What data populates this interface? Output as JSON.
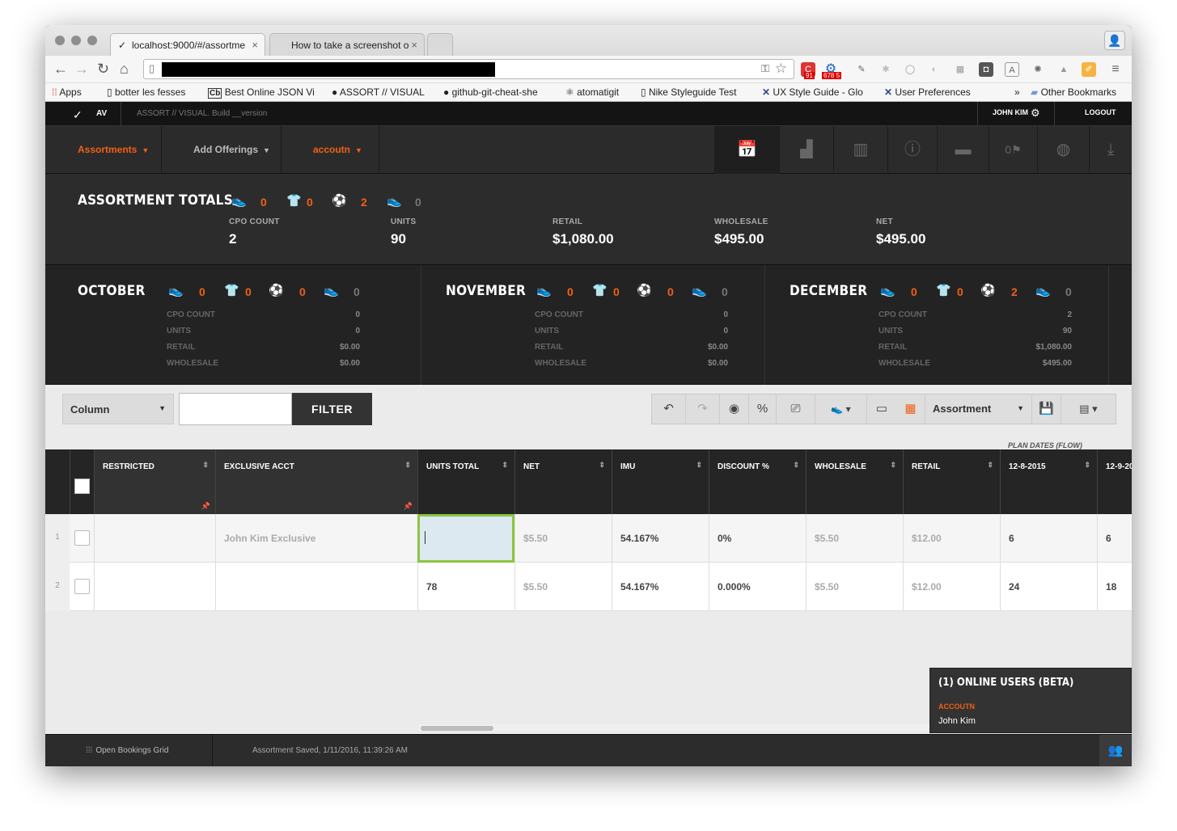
{
  "browser": {
    "tabs": [
      {
        "title": "localhost:9000/#/assortme",
        "icon": "nike-swoosh-icon"
      },
      {
        "title": "How to take a screenshot o",
        "icon": "apple-icon"
      }
    ],
    "bookmarks": [
      {
        "label": "Apps",
        "icon": "apps-grid-icon"
      },
      {
        "label": "botter les fesses",
        "icon": "page-icon"
      },
      {
        "label": "Best Online JSON Vi",
        "icon": "cb-icon"
      },
      {
        "label": "ASSORT // VISUAL",
        "icon": "github-icon"
      },
      {
        "label": "github-git-cheat-she",
        "icon": "github-icon"
      },
      {
        "label": "atomatigit",
        "icon": "atom-icon"
      },
      {
        "label": "Nike Styleguide Test",
        "icon": "page-icon"
      },
      {
        "label": "UX Style Guide - Glo",
        "icon": "x-icon"
      },
      {
        "label": "User Preferences",
        "icon": "x-icon"
      },
      {
        "label": "»",
        "icon": ""
      },
      {
        "label": "Other Bookmarks",
        "icon": "folder-icon"
      }
    ],
    "badges": {
      "ext1": "91",
      "ext2": "678 5"
    }
  },
  "app": {
    "logo_text": "AV",
    "build": "ASSORT // VISUAL. Build __version",
    "user": "JOHN KIM",
    "logout": "LOGOUT",
    "menu": {
      "assortments": "Assortments",
      "add_offerings": "Add Offerings",
      "account": "accoutn"
    },
    "flag_count": "0"
  },
  "totals": {
    "title": "ASSORTMENT TOTALS",
    "counts": {
      "footwear": "0",
      "apparel": "0",
      "equipment": "2",
      "other": "0"
    },
    "cpo_label": "CPO COUNT",
    "cpo": "2",
    "units_label": "UNITS",
    "units": "90",
    "retail_label": "RETAIL",
    "retail": "$1,080.00",
    "wholesale_label": "WHOLESALE",
    "wholesale": "$495.00",
    "net_label": "NET",
    "net": "$495.00"
  },
  "months": [
    {
      "name": "OCTOBER",
      "footwear": "0",
      "apparel": "0",
      "equipment": "0",
      "other": "0",
      "cpo_label": "CPO COUNT",
      "cpo": "0",
      "units_label": "UNITS",
      "units": "0",
      "retail_label": "RETAIL",
      "retail": "$0.00",
      "wholesale_label": "WHOLESALE",
      "wholesale": "$0.00"
    },
    {
      "name": "NOVEMBER",
      "footwear": "0",
      "apparel": "0",
      "equipment": "0",
      "other": "0",
      "cpo_label": "CPO COUNT",
      "cpo": "0",
      "units_label": "UNITS",
      "units": "0",
      "retail_label": "RETAIL",
      "retail": "$0.00",
      "wholesale_label": "WHOLESALE",
      "wholesale": "$0.00"
    },
    {
      "name": "DECEMBER",
      "footwear": "0",
      "apparel": "0",
      "equipment": "2",
      "other": "0",
      "cpo_label": "CPO COUNT",
      "cpo": "2",
      "units_label": "UNITS",
      "units": "90",
      "retail_label": "RETAIL",
      "retail": "$1,080.00",
      "wholesale_label": "WHOLESALE",
      "wholesale": "$495.00"
    }
  ],
  "filterbar": {
    "column_select": "Column",
    "filter_value": "",
    "filter_button": "FILTER",
    "percent": "%",
    "view_select": "Assortment"
  },
  "grid": {
    "plan_dates_label": "PLAN DATES (FLOW)",
    "columns": [
      "RESTRICTED",
      "EXCLUSIVE ACCT",
      "UNITS TOTAL",
      "NET",
      "IMU",
      "DISCOUNT %",
      "WHOLESALE",
      "RETAIL",
      "12-8-2015",
      "12-9-20"
    ],
    "rows": [
      {
        "num": "1",
        "restricted": "",
        "exclusive": "John Kim Exclusive",
        "units": "",
        "net": "$5.50",
        "imu": "54.167%",
        "discount": "0%",
        "wholesale": "$5.50",
        "retail": "$12.00",
        "d1": "6",
        "d2": "6"
      },
      {
        "num": "2",
        "restricted": "",
        "exclusive": "",
        "units": "78",
        "net": "$5.50",
        "imu": "54.167%",
        "discount": "0.000%",
        "wholesale": "$5.50",
        "retail": "$12.00",
        "d1": "24",
        "d2": "18"
      }
    ]
  },
  "online": {
    "title": "(1) ONLINE USERS (BETA)",
    "account": "ACCOUTN",
    "user": "John Kim"
  },
  "bottom": {
    "open_grid": "Open Bookings Grid",
    "status": "Assortment Saved, 1/11/2016, 11:39:26 AM"
  },
  "colors": {
    "accent": "#f06017",
    "edit_border": "#8cc63f",
    "edit_bg": "#dde9f1"
  }
}
